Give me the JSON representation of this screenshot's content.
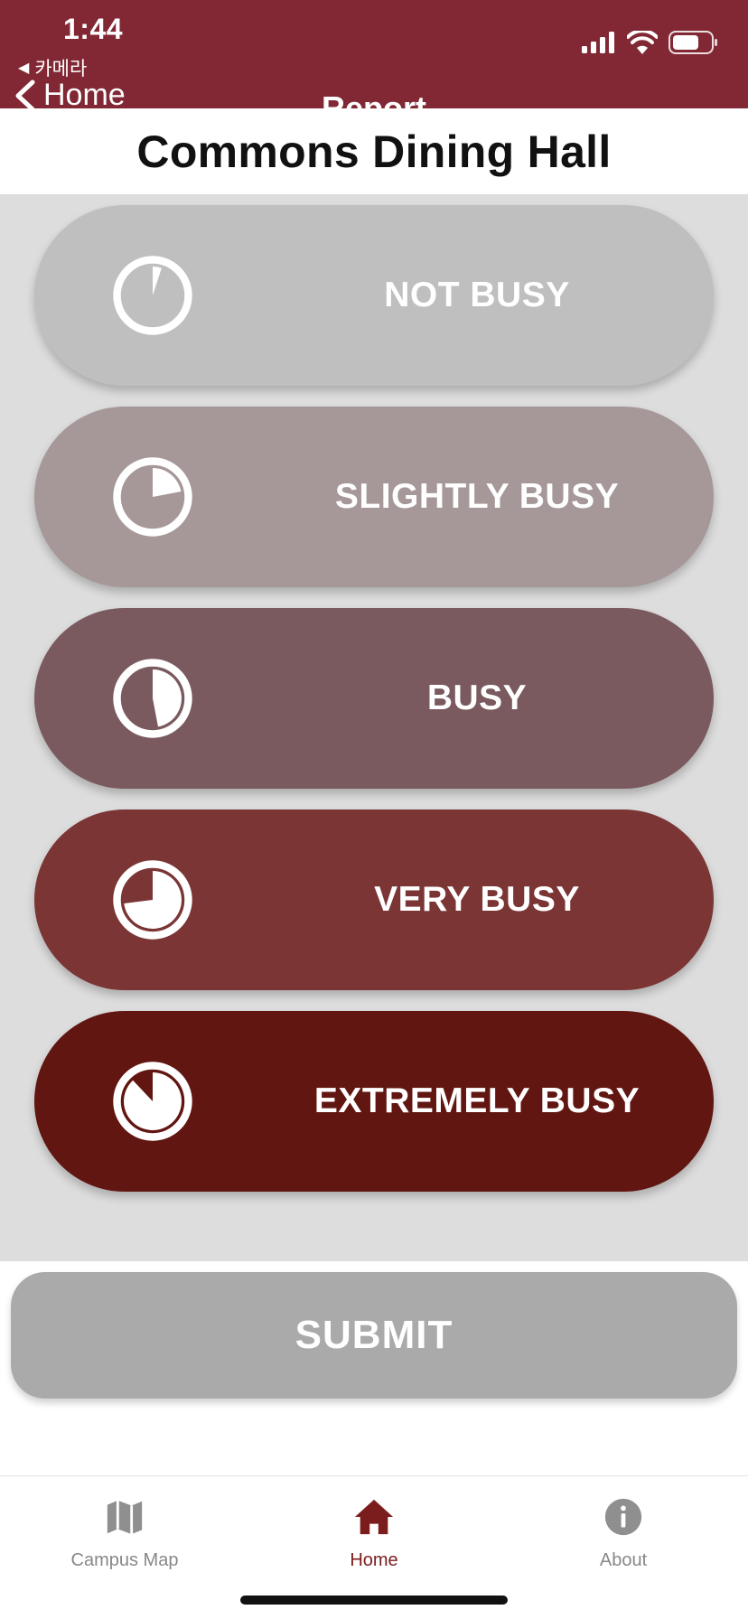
{
  "status_bar": {
    "time": "1:44",
    "back_app": "카메라"
  },
  "nav": {
    "back_label": "Home",
    "title": "Report"
  },
  "header": {
    "title": "Commons Dining Hall"
  },
  "options": [
    {
      "label": "NOT BUSY",
      "level": 0.05,
      "color": "#bfbfbf"
    },
    {
      "label": "SLIGHTLY BUSY",
      "level": 0.22,
      "color": "#a69898"
    },
    {
      "label": "BUSY",
      "level": 0.47,
      "color": "#7a5a5e"
    },
    {
      "label": "VERY BUSY",
      "level": 0.73,
      "color": "#7b3535"
    },
    {
      "label": "EXTREMELY BUSY",
      "level": 0.88,
      "color": "#611611"
    }
  ],
  "submit": {
    "label": "SUBMIT"
  },
  "tabs": [
    {
      "label": "Campus Map",
      "icon": "map-icon",
      "active": false
    },
    {
      "label": "Home",
      "icon": "home-icon",
      "active": true
    },
    {
      "label": "About",
      "icon": "info-icon",
      "active": false
    }
  ],
  "colors": {
    "header_bg": "#812834",
    "panel_bg": "#dddddd",
    "submit_bg": "#aaaaaa",
    "active_tab": "#7c1d1d",
    "inactive_tab": "#888888"
  }
}
